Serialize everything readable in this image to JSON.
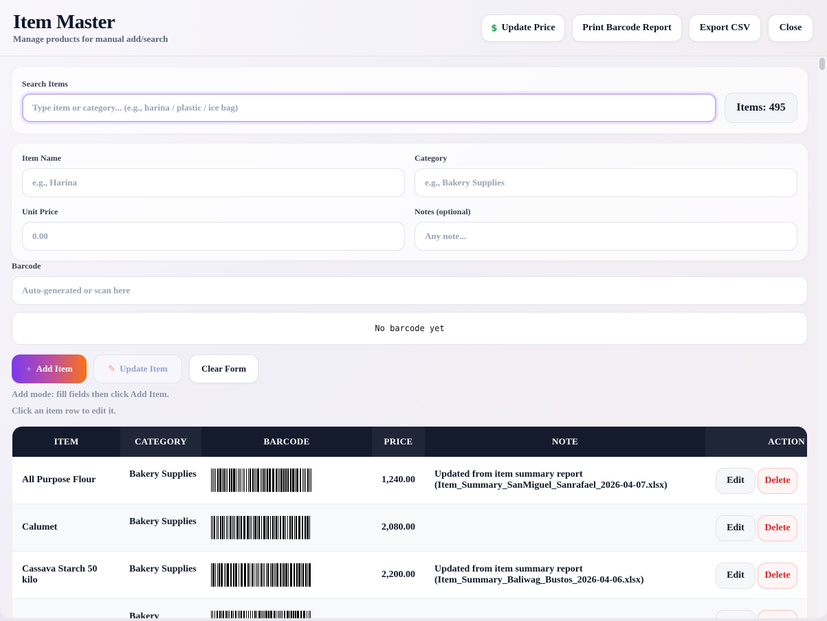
{
  "header": {
    "title": "Item Master",
    "subtitle": "Manage products for manual add/search",
    "update_price": "Update Price",
    "print_barcode": "Print Barcode Report",
    "export_csv": "Export CSV",
    "close": "Close"
  },
  "search": {
    "label": "Search Items",
    "placeholder": "Type item or category... (e.g., harina / plastic / ice bag)",
    "count": "Items: 495"
  },
  "form": {
    "item_name_label": "Item Name",
    "item_name_placeholder": "e.g., Harina",
    "category_label": "Category",
    "category_placeholder": "e.g., Bakery Supplies",
    "unit_price_label": "Unit Price",
    "unit_price_placeholder": "0.00",
    "notes_label": "Notes (optional)",
    "notes_placeholder": "Any note...",
    "barcode_label": "Barcode",
    "barcode_placeholder": "Auto-generated or scan here",
    "barcode_preview": "No barcode yet"
  },
  "actions": {
    "add": "Add Item",
    "update": "Update Item",
    "clear": "Clear Form",
    "hint_mode": "Add mode: fill fields then click Add Item.",
    "hint_edit": "Click an item row to edit it."
  },
  "table": {
    "columns": [
      "ITEM",
      "CATEGORY",
      "BARCODE",
      "PRICE",
      "NOTE",
      "ACTION"
    ],
    "rows": [
      {
        "item": "All Purpose Flour",
        "category": "Bakery Supplies",
        "price": "1,240.00",
        "note": "Updated from item summary report (Item_Summary_SanMiguel_Sanrafael_2026-04-07.xlsx)",
        "edit": "Edit",
        "delete": "Delete"
      },
      {
        "item": "Calumet",
        "category": "Bakery Supplies",
        "price": "2,080.00",
        "note": "",
        "edit": "Edit",
        "delete": "Delete"
      },
      {
        "item": "Cassava Starch 50 kilo",
        "category": "Bakery Supplies",
        "price": "2,200.00",
        "note": "Updated from item summary report (Item_Summary_Baliwag_Bustos_2026-04-06.xlsx)",
        "edit": "Edit",
        "delete": "Delete"
      },
      {
        "item": "",
        "category": "Bakery",
        "price": "",
        "note": "",
        "edit": "",
        "delete": ""
      }
    ]
  },
  "colors": {
    "header_dark": "#141b2d",
    "accent_purple": "#7c3aed",
    "accent_orange": "#f97316",
    "delete_red": "#dc2626",
    "dollar_green": "#16a34a"
  },
  "icons": {
    "update_price": "dollar-icon",
    "add": "sparkle-icon",
    "update": "pencil-icon"
  }
}
